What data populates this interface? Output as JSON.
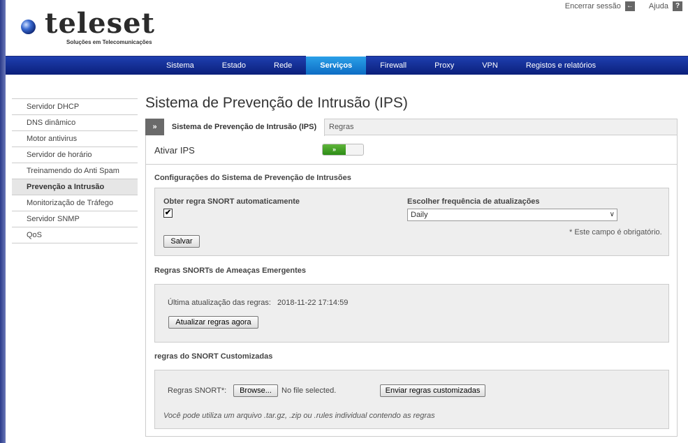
{
  "header": {
    "brand": "teleset",
    "tagline": "Soluções em Telecomunicações",
    "logout_label": "Encerrar sessão",
    "help_label": "Ajuda"
  },
  "nav": {
    "items": [
      "Sistema",
      "Estado",
      "Rede",
      "Serviços",
      "Firewall",
      "Proxy",
      "VPN",
      "Registos e relatórios"
    ],
    "active": "Serviços"
  },
  "sidebar": {
    "items": [
      "Servidor DHCP",
      "DNS dinâmico",
      "Motor antivirus",
      "Servidor de horário",
      "Treinamendo do Anti Spam",
      "Prevenção a Intrusão",
      "Monitorização de Tráfego",
      "Servidor SNMP",
      "QoS"
    ],
    "active": "Prevenção a Intrusão"
  },
  "page": {
    "title": "Sistema de Prevenção de Intrusão (IPS)",
    "tabs": {
      "arrow": "»",
      "ips": "Sistema de Prevenção de Intrusão (IPS)",
      "regras": "Regras"
    },
    "enable_ips": {
      "label": "Ativar IPS",
      "toggle_label": "»",
      "state": "on"
    },
    "config": {
      "title": "Configurações do Sistema de Prevenção de Intrusões",
      "auto_rule_label": "Obter regra SNORT automaticamente",
      "auto_rule_checked": true,
      "checkbox_mark": "✔",
      "freq_label": "Escolher frequência de atualizações",
      "freq_value": "Daily",
      "required_note": "* Este campo é obrigatório.",
      "save_label": "Salvar"
    },
    "emerging": {
      "title": "Regras SNORTs de Ameaças Emergentes",
      "last_update_label": "Última atualização das regras:",
      "last_update_value": "2018-11-22 17:14:59",
      "update_button": "Atualizar regras agora"
    },
    "custom": {
      "title": "regras do SNORT Customizadas",
      "file_label": "Regras SNORT*:",
      "browse_label": "Browse...",
      "no_file": "No file selected.",
      "send_button": "Enviar regras customizadas",
      "hint": "Você pode utiliza um arquivo .tar.gz, .zip ou .rules individual contendo as regras"
    }
  }
}
